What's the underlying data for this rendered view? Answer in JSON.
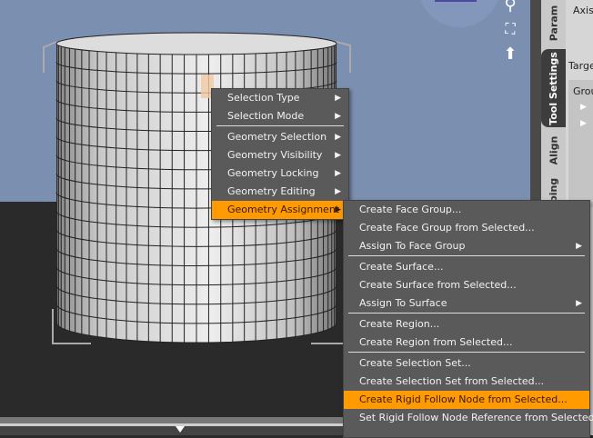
{
  "context_menu": {
    "items": [
      {
        "label": "Selection Type",
        "submenu": true
      },
      {
        "label": "Selection Mode",
        "submenu": true
      },
      {
        "separator": true
      },
      {
        "label": "Geometry Selection",
        "submenu": true
      },
      {
        "label": "Geometry Visibility",
        "submenu": true
      },
      {
        "label": "Geometry Locking",
        "submenu": true
      },
      {
        "label": "Geometry Editing",
        "submenu": true
      },
      {
        "label": "Geometry Assignment",
        "submenu": true,
        "highlighted": true
      }
    ]
  },
  "submenu": {
    "items": [
      {
        "label": "Create Face Group..."
      },
      {
        "label": "Create Face Group from Selected..."
      },
      {
        "label": "Assign To Face Group",
        "submenu": true
      },
      {
        "separator": true
      },
      {
        "label": "Create Surface..."
      },
      {
        "label": "Create Surface from Selected..."
      },
      {
        "label": "Assign To Surface",
        "submenu": true
      },
      {
        "separator": true
      },
      {
        "label": "Create Region..."
      },
      {
        "label": "Create Region from Selected..."
      },
      {
        "separator": true
      },
      {
        "label": "Create Selection Set..."
      },
      {
        "label": "Create Selection Set from Selected..."
      },
      {
        "label": "Create Rigid Follow Node from Selected...",
        "highlighted": true
      },
      {
        "label": "Set Rigid Follow Node Reference from Selected..."
      }
    ]
  },
  "tabs": {
    "params": "Param",
    "tool_settings": "Tool Settings",
    "align": "Align",
    "shaping": "ping"
  },
  "panel": {
    "axis": "Axis",
    "target": "Targe",
    "group": "Grou"
  },
  "arrow": "▶",
  "icons": {
    "zoom": "magnifier-icon",
    "frame": "frame-icon",
    "orbit": "orbit-icon"
  },
  "colors": {
    "highlight": "#ff9a00",
    "menu_bg": "#5a5a5a",
    "viewport_bg": "#7b8fb1"
  }
}
